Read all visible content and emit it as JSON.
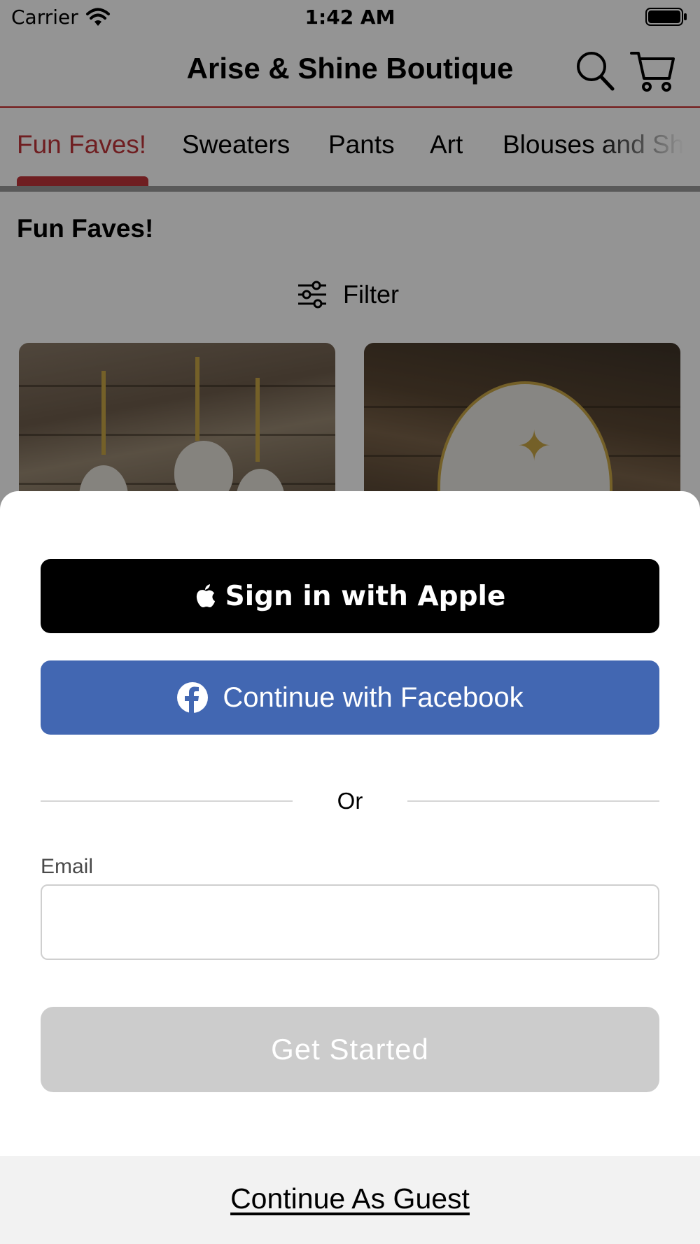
{
  "status_bar": {
    "carrier": "Carrier",
    "time": "1:42 AM"
  },
  "nav": {
    "title": "Arise & Shine Boutique",
    "search_icon": "search-icon",
    "cart_icon": "cart-icon"
  },
  "tabs": [
    {
      "label": "Fun Faves!",
      "active": true
    },
    {
      "label": "Sweaters",
      "active": false
    },
    {
      "label": "Pants",
      "active": false
    },
    {
      "label": "Art",
      "active": false
    },
    {
      "label": "Blouses and Sh",
      "active": false
    }
  ],
  "section": {
    "title": "Fun Faves!",
    "filter_label": "Filter"
  },
  "sign_in_sheet": {
    "apple_button": "Sign in with Apple",
    "facebook_button": "Continue with Facebook",
    "divider_text": "Or",
    "email_label": "Email",
    "email_value": "",
    "get_started_button": "Get Started",
    "guest_link": "Continue As Guest"
  },
  "colors": {
    "accent": "#c0353a",
    "facebook": "#4267b2",
    "apple": "#000000",
    "disabled_button": "#cccccc",
    "guest_bar": "#f2f2f2"
  }
}
